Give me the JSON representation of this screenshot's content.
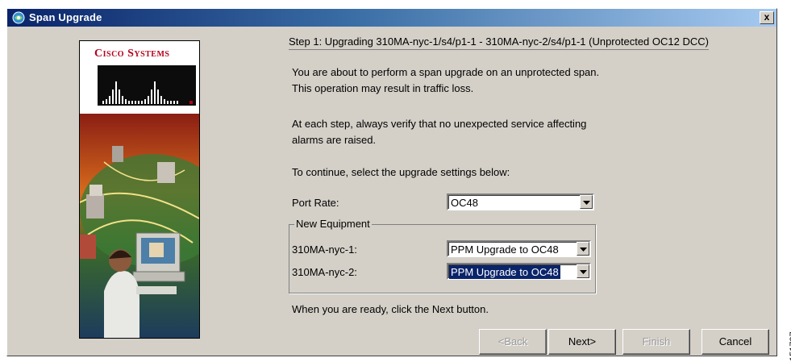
{
  "window": {
    "title": "Span Upgrade",
    "close_label": "x"
  },
  "logo": {
    "text": "Cisco Systems"
  },
  "step_header": "Step 1: Upgrading 310MA-nyc-1/s4/p1-1 - 310MA-nyc-2/s4/p1-1 (Unprotected OC12 DCC)",
  "paragraphs": {
    "p1_line1": "You are about to perform a span upgrade on an unprotected span.",
    "p1_line2": "This operation may result in traffic loss.",
    "p2_line1": "At each step, always verify that no unexpected service affecting",
    "p2_line2": "alarms are raised.",
    "p3": "To continue, select the upgrade settings below:",
    "p4": "When you are ready, click the Next button."
  },
  "port_rate": {
    "label": "Port Rate:",
    "value": "OC48"
  },
  "new_equipment": {
    "legend": "New Equipment",
    "node1": {
      "label": "310MA-nyc-1:",
      "value": "PPM Upgrade to OC48"
    },
    "node2": {
      "label": "310MA-nyc-2:",
      "value": "PPM Upgrade to OC48"
    }
  },
  "buttons": {
    "back": "<Back",
    "next": "Next>",
    "finish": "Finish",
    "cancel": "Cancel"
  },
  "side_code": "151797",
  "colors": {
    "title_start": "#0a246a",
    "title_end": "#a6caf0",
    "selection": "#0a246a",
    "logo_red": "#b3001b"
  }
}
